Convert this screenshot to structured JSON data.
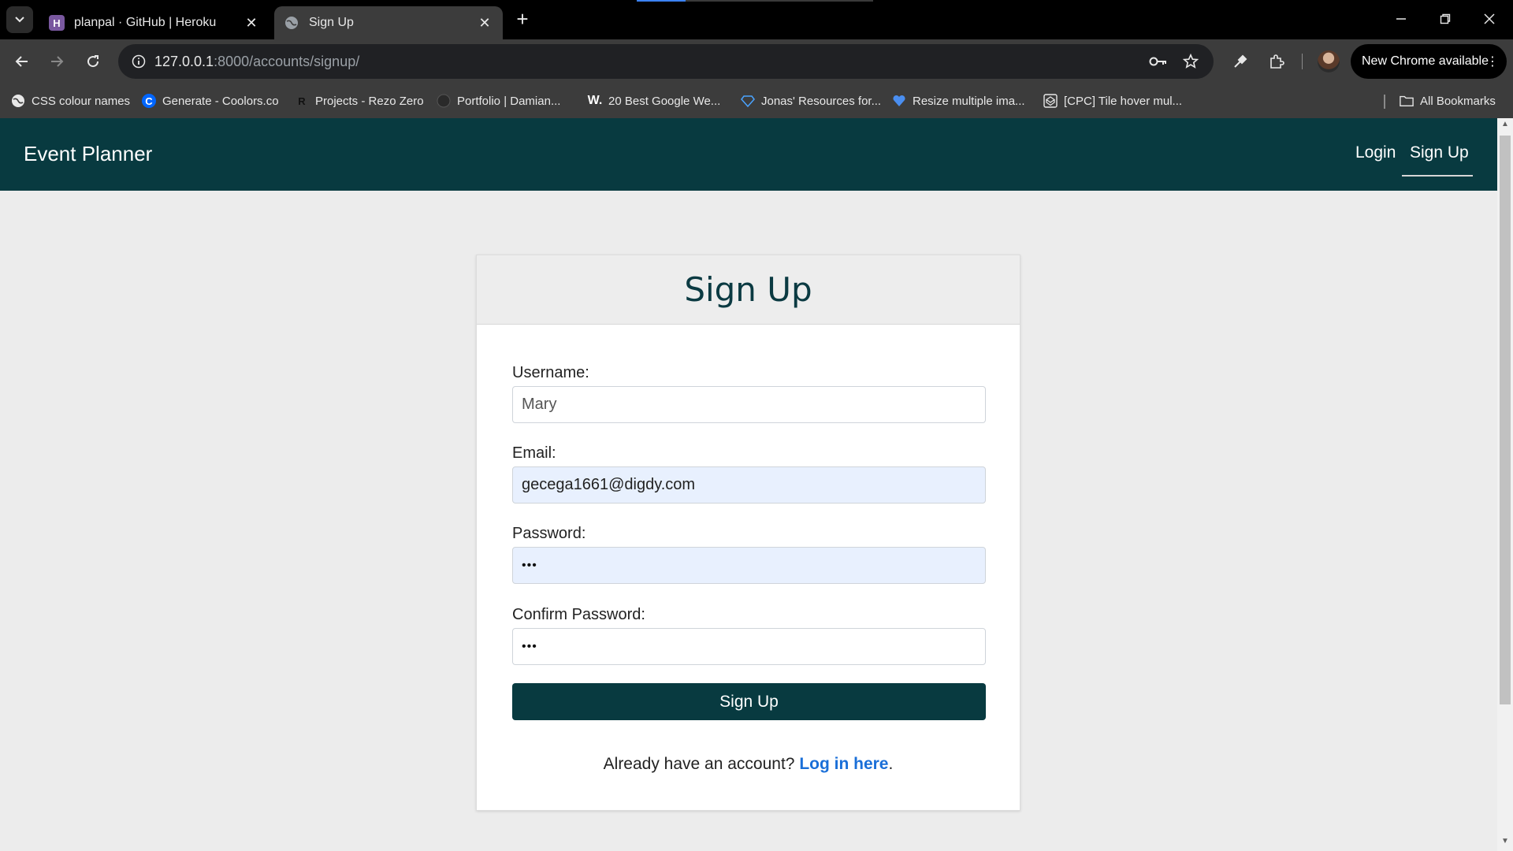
{
  "browser": {
    "tabs": [
      {
        "title": "planpal · GitHub | Heroku",
        "active": false,
        "favicon": "heroku-icon"
      },
      {
        "title": "Sign Up",
        "active": true,
        "favicon": "globe-icon"
      }
    ],
    "new_tab_label": "+",
    "url_host": "127.0.0.1",
    "url_path": ":8000/accounts/signup/",
    "new_chrome_label": "New Chrome available",
    "bookmarks": [
      {
        "label": "CSS colour names",
        "icon": "globe-icon"
      },
      {
        "label": "Generate - Coolors.co",
        "icon": "coolors-icon"
      },
      {
        "label": "Projects - Rezo Zero",
        "icon": "rezo-icon"
      },
      {
        "label": "Portfolio | Damian...",
        "icon": "portfolio-icon"
      },
      {
        "label": "20 Best Google We...",
        "icon": "w-icon"
      },
      {
        "label": "Jonas' Resources for...",
        "icon": "diamond-icon"
      },
      {
        "label": "Resize multiple ima...",
        "icon": "heart-icon"
      },
      {
        "label": "[CPC] Tile hover mul...",
        "icon": "codepen-icon"
      }
    ],
    "all_bookmarks_label": "All Bookmarks"
  },
  "navbar": {
    "brand": "Event Planner",
    "links": {
      "login": "Login",
      "signup": "Sign Up"
    }
  },
  "form": {
    "title": "Sign Up",
    "username_label": "Username:",
    "username_value": "Mary",
    "email_label": "Email:",
    "email_value": "gecega1661@digdy.com",
    "password_label": "Password:",
    "password_value": "•••",
    "confirm_label": "Confirm Password:",
    "confirm_value": "•••",
    "submit_label": "Sign Up",
    "footer_prefix": "Already have an account? ",
    "footer_link": "Log in here",
    "footer_suffix": "."
  },
  "colors": {
    "navbar_bg": "#083a40",
    "link": "#1a6fd8",
    "autofill_bg": "#e8f0fe"
  }
}
